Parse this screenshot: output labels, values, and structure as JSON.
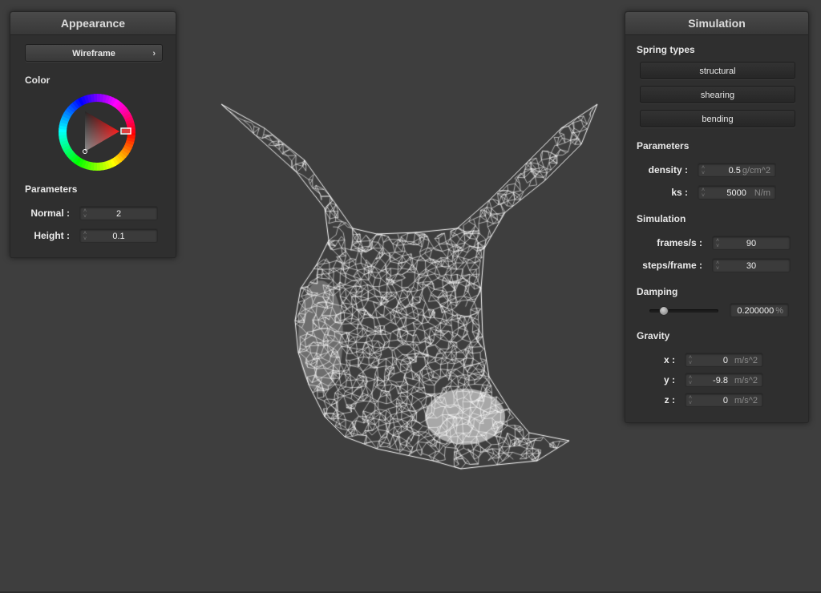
{
  "appearance": {
    "title": "Appearance",
    "render_mode": "Wireframe",
    "color_label": "Color",
    "parameters_label": "Parameters",
    "params": [
      {
        "label": "Normal :",
        "value": "2"
      },
      {
        "label": "Height :",
        "value": "0.1"
      }
    ],
    "selected_color": "#ff0000"
  },
  "simulation": {
    "title": "Simulation",
    "spring_types_label": "Spring types",
    "spring_types": [
      "structural",
      "shearing",
      "bending"
    ],
    "parameters_label": "Parameters",
    "density": {
      "label": "density :",
      "value": "0.5",
      "unit": "g/cm^2"
    },
    "ks": {
      "label": "ks :",
      "value": "5000",
      "unit": "N/m"
    },
    "simulation_label": "Simulation",
    "frames": {
      "label": "frames/s :",
      "value": "90"
    },
    "steps": {
      "label": "steps/frame :",
      "value": "30"
    },
    "damping_label": "Damping",
    "damping": {
      "value": "0.200000",
      "unit": "%",
      "fraction": 0.2
    },
    "gravity_label": "Gravity",
    "gravity": [
      {
        "label": "x :",
        "value": "0",
        "unit": "m/s^2"
      },
      {
        "label": "y :",
        "value": "-9.8",
        "unit": "m/s^2"
      },
      {
        "label": "z :",
        "value": "0",
        "unit": "m/s^2"
      }
    ]
  },
  "viewport": {
    "mesh_color": "#ffffff",
    "background": "#3e3e3e"
  }
}
